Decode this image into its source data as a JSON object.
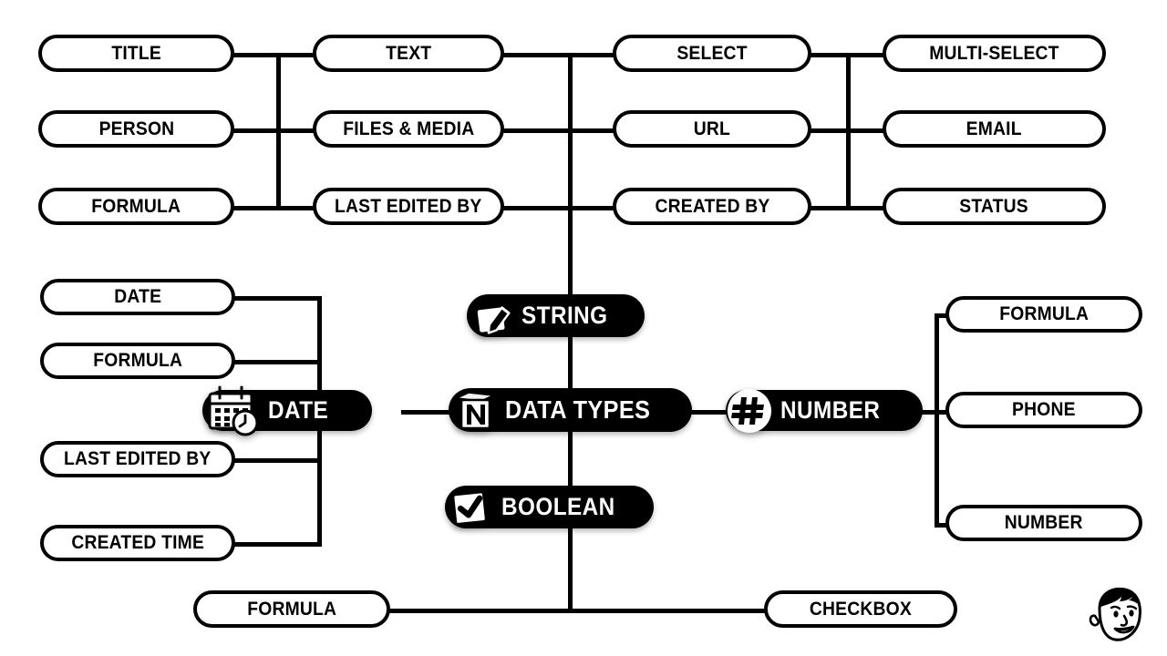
{
  "diagram": {
    "title": "DATA TYPES",
    "center_node": {
      "label": "DATA TYPES",
      "icon": "notion-logo-icon"
    },
    "colors": {
      "background": "#FFFFFF",
      "stroke": "#000000",
      "node_fill": "#000000",
      "node_text": "#FFFFFF",
      "pill_fill": "#FFFFFF",
      "pill_text": "#000000"
    },
    "branches": [
      {
        "id": "string",
        "label": "STRING",
        "icon": "edit-box-icon",
        "children": [
          {
            "label": "TITLE"
          },
          {
            "label": "PERSON"
          },
          {
            "label": "FORMULA"
          },
          {
            "label": "TEXT"
          },
          {
            "label": "FILES & MEDIA"
          },
          {
            "label": "LAST EDITED BY"
          },
          {
            "label": "SELECT"
          },
          {
            "label": "URL"
          },
          {
            "label": "CREATED BY"
          },
          {
            "label": "MULTI-SELECT"
          },
          {
            "label": "EMAIL"
          },
          {
            "label": "STATUS"
          }
        ]
      },
      {
        "id": "date",
        "label": "DATE",
        "icon": "calendar-clock-icon",
        "children": [
          {
            "label": "DATE"
          },
          {
            "label": "FORMULA"
          },
          {
            "label": "LAST EDITED BY"
          },
          {
            "label": "CREATED TIME"
          }
        ]
      },
      {
        "id": "number",
        "label": "NUMBER",
        "icon": "hash-icon",
        "children": [
          {
            "label": "FORMULA"
          },
          {
            "label": "PHONE"
          },
          {
            "label": "NUMBER"
          }
        ]
      },
      {
        "id": "boolean",
        "label": "BOOLEAN",
        "icon": "checked-checkbox-icon",
        "children": [
          {
            "label": "FORMULA"
          },
          {
            "label": "CHECKBOX"
          }
        ]
      }
    ],
    "pills": {
      "title": "TITLE",
      "person": "PERSON",
      "formula_top": "FORMULA",
      "text": "TEXT",
      "files_media": "FILES & MEDIA",
      "last_edited_by_top": "LAST EDITED BY",
      "select": "SELECT",
      "url": "URL",
      "created_by": "CREATED BY",
      "multi_select": "MULTI-SELECT",
      "email": "EMAIL",
      "status": "STATUS",
      "date_left": "DATE",
      "formula_date": "FORMULA",
      "last_edited_by_date": "LAST EDITED BY",
      "created_time": "CREATED TIME",
      "formula_number": "FORMULA",
      "phone": "PHONE",
      "number_right": "NUMBER",
      "formula_bottom": "FORMULA",
      "checkbox": "CHECKBOX"
    },
    "nodes": {
      "string": "STRING",
      "data_types": "DATA TYPES",
      "date": "DATE",
      "number": "NUMBER",
      "boolean": "BOOLEAN"
    },
    "watermark": {
      "name": "cartoon-face-avatar"
    }
  }
}
